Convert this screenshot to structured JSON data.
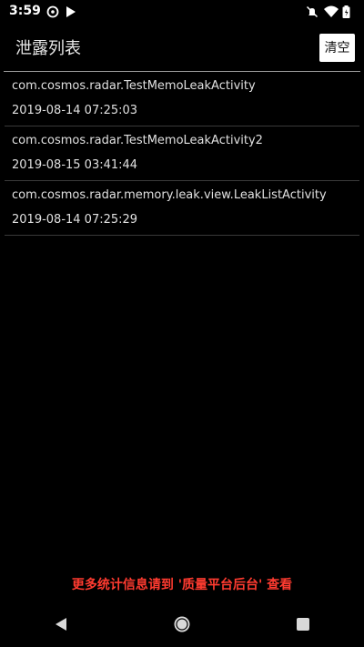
{
  "status_bar": {
    "time": "3:59",
    "left_icons": [
      "sync-icon",
      "play-store-icon"
    ],
    "right_icons": [
      "notifications-off-icon",
      "wifi-icon",
      "battery-icon"
    ]
  },
  "header": {
    "title": "泄露列表",
    "clear_label": "清空"
  },
  "leaks": [
    {
      "name": "com.cosmos.radar.TestMemoLeakActivity",
      "time": "2019-08-14 07:25:03"
    },
    {
      "name": "com.cosmos.radar.TestMemoLeakActivity2",
      "time": "2019-08-15 03:41:44"
    },
    {
      "name": "com.cosmos.radar.memory.leak.view.LeakListActivity",
      "time": "2019-08-14 07:25:29"
    }
  ],
  "footer": {
    "hint": "更多统计信息请到 '质量平台后台' 查看",
    "hint_color": "#ff3b30"
  },
  "nav_bar": {
    "buttons": [
      "back-icon",
      "home-icon",
      "recents-icon"
    ]
  }
}
